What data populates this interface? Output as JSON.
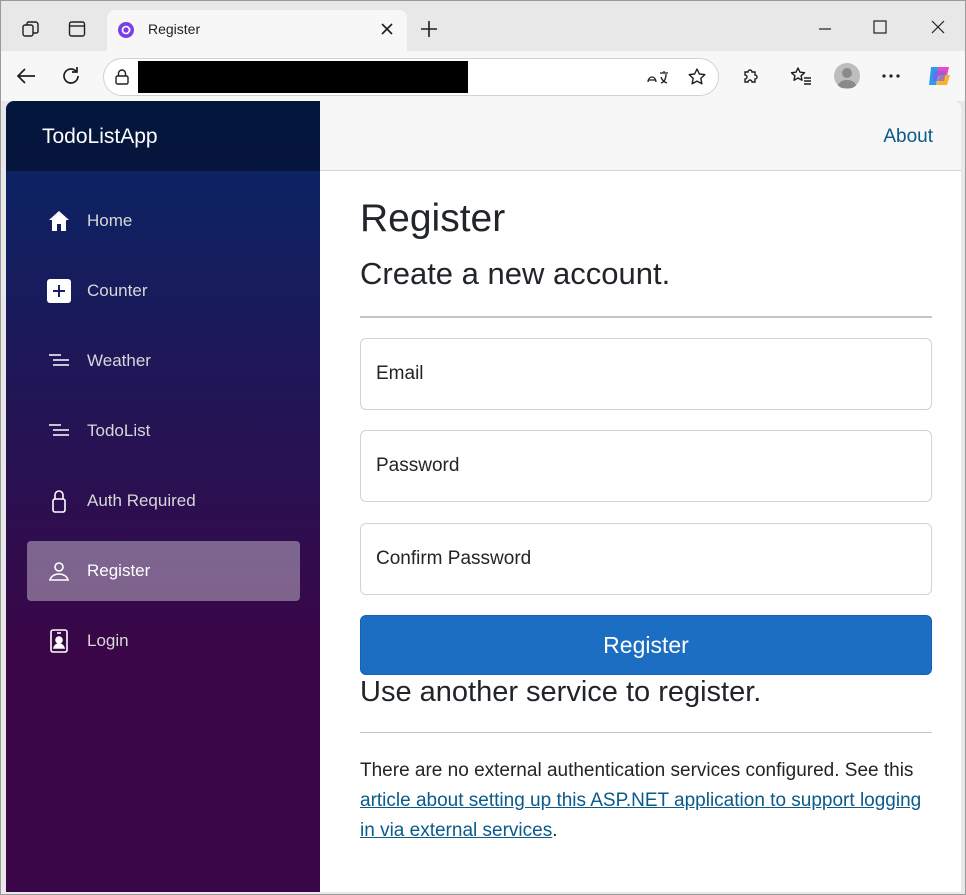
{
  "browser": {
    "tab_title": "Register",
    "icons": {
      "workspaces": "workspaces-icon",
      "tab_actions": "vertical-tabs-icon",
      "tab_favicon": "blazor-icon",
      "close_tab": "close-icon",
      "new_tab": "plus-icon",
      "minimize": "minimize-icon",
      "maximize": "maximize-icon",
      "close_window": "close-icon",
      "back": "back-arrow-icon",
      "refresh": "refresh-icon",
      "site_info": "lock-icon",
      "read_aloud": "translate-icon",
      "favorite": "star-icon",
      "extensions": "puzzle-icon",
      "favorites": "favorites-icon",
      "profile": "profile-avatar",
      "more": "more-icon",
      "copilot": "copilot-icon"
    }
  },
  "app": {
    "brand": "TodoListApp",
    "about": "About",
    "nav": [
      {
        "label": "Home",
        "icon": "house-icon"
      },
      {
        "label": "Counter",
        "icon": "plus-square-icon"
      },
      {
        "label": "Weather",
        "icon": "list-icon"
      },
      {
        "label": "TodoList",
        "icon": "list-icon"
      },
      {
        "label": "Auth Required",
        "icon": "lock-icon"
      },
      {
        "label": "Register",
        "icon": "person-icon",
        "active": true
      },
      {
        "label": "Login",
        "icon": "person-badge-icon"
      }
    ]
  },
  "form": {
    "title": "Register",
    "subtitle": "Create a new account.",
    "email_placeholder": "Email",
    "password_placeholder": "Password",
    "confirm_placeholder": "Confirm Password",
    "submit_label": "Register"
  },
  "external": {
    "heading": "Use another service to register.",
    "text_before": "There are no external authentication services configured. See this ",
    "link_text": "article about setting up this ASP.NET application to support logging in via external services",
    "text_after": "."
  },
  "colors": {
    "primary_button": "#1b6ec2",
    "link": "#0a5a8a",
    "sidebar_top": "#052767",
    "sidebar_bottom": "#3a0647"
  }
}
